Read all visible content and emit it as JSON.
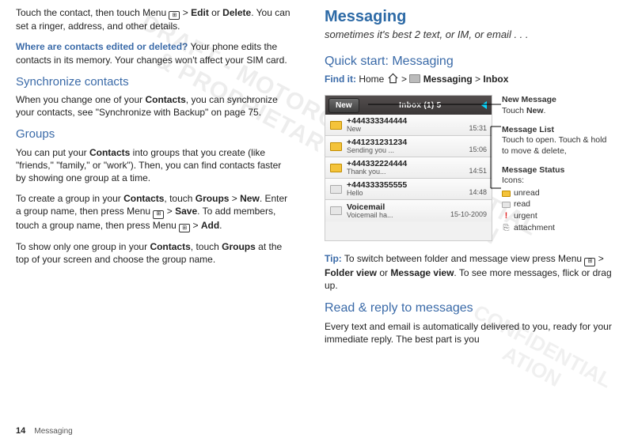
{
  "left": {
    "p1a": "Touch the contact, then touch Menu ",
    "p1b": " > ",
    "p1_edit": "Edit",
    "p1_or": " or ",
    "p1_delete": "Delete",
    "p1c": ". You can set a ringer, address, and other details.",
    "q1": "Where are contacts edited or deleted?",
    "q1b": " Your phone edits the contacts in its memory. Your changes won't affect your SIM card.",
    "h_sync": "Synchronize contacts",
    "p_sync_a": "When you change one of your ",
    "p_sync_contacts": "Contacts",
    "p_sync_b": ", you can synchronize your contacts, see \"Synchronize with Backup\" on page 75.",
    "h_groups": "Groups",
    "p_groups_a": "You can put your ",
    "p_groups_b": " into groups that you create (like \"friends,\" \"family,\" or \"work\"). Then, you can find contacts faster by showing one group at a time.",
    "p_create_a": "To create a group in your ",
    "p_create_b": ", touch ",
    "p_create_groups": "Groups",
    "p_create_gt1": " > ",
    "p_create_new": "New",
    "p_create_c": ". Enter a group name, then press Menu ",
    "p_create_gt2": " > ",
    "p_create_save": "Save",
    "p_create_d": ". To add members, touch a group name, then press Menu ",
    "p_create_gt3": " > ",
    "p_create_add": "Add",
    "p_create_e": ".",
    "p_show_a": "To show only one group in your ",
    "p_show_b": ", touch ",
    "p_show_c": " at the top of your screen and choose the group name."
  },
  "right": {
    "h_messaging": "Messaging",
    "sub": "sometimes it's best 2 text, or IM, or email . . .",
    "h_quick": "Quick start: Messaging",
    "findit": "Find it:",
    "home": " Home ",
    "gt": " > ",
    "msg_label": " Messaging",
    "inbox_label": "Inbox",
    "phone": {
      "new": "New",
      "title": "Inbox (1) 5",
      "rows": [
        {
          "num": "+444333344444",
          "sub": "New",
          "time": "15:31",
          "read": false
        },
        {
          "num": "+441231231234",
          "sub": "Sending you ...",
          "time": "15:06",
          "read": false
        },
        {
          "num": "+444332224444",
          "sub": "Thank you...",
          "time": "14:51",
          "read": false
        },
        {
          "num": "+444333355555",
          "sub": "Hello",
          "time": "14:48",
          "read": true
        },
        {
          "num": "Voicemail",
          "sub": "Voicemail ha...",
          "time": "15-10-2009",
          "read": true
        }
      ]
    },
    "call_newmsg_t": "New Message",
    "call_newmsg_b": "Touch ",
    "call_newmsg_bold": "New",
    "call_newmsg_c": ".",
    "call_list_t": "Message List",
    "call_list_b": "Touch to open. Touch & hold to move & delete,",
    "call_status_t": "Message Status",
    "call_status_b": "Icons:",
    "ic_unread": "unread",
    "ic_read": "read",
    "ic_urgent": "urgent",
    "ic_attach": "attachment",
    "tip": "Tip:",
    "tip_a": " To switch between folder and message view press Menu ",
    "tip_gt": " > ",
    "tip_folder": "Folder view",
    "tip_or": " or ",
    "tip_msgview": "Message view",
    "tip_b": ". To see more messages, flick or drag up.",
    "h_read": "Read & reply to messages",
    "p_read": "Every text and email is automatically delivered to you, ready for your immediate reply. The best part is you"
  },
  "footer_page": "14",
  "footer_section": "Messaging",
  "wm1a": "DRAFT - MOTOROLA CONFIDENTIAL",
  "wm1b": "& PROPRIETARY INFORMATION",
  "wm2a": "CONFIDENTIAL",
  "wm2b": "ATION"
}
